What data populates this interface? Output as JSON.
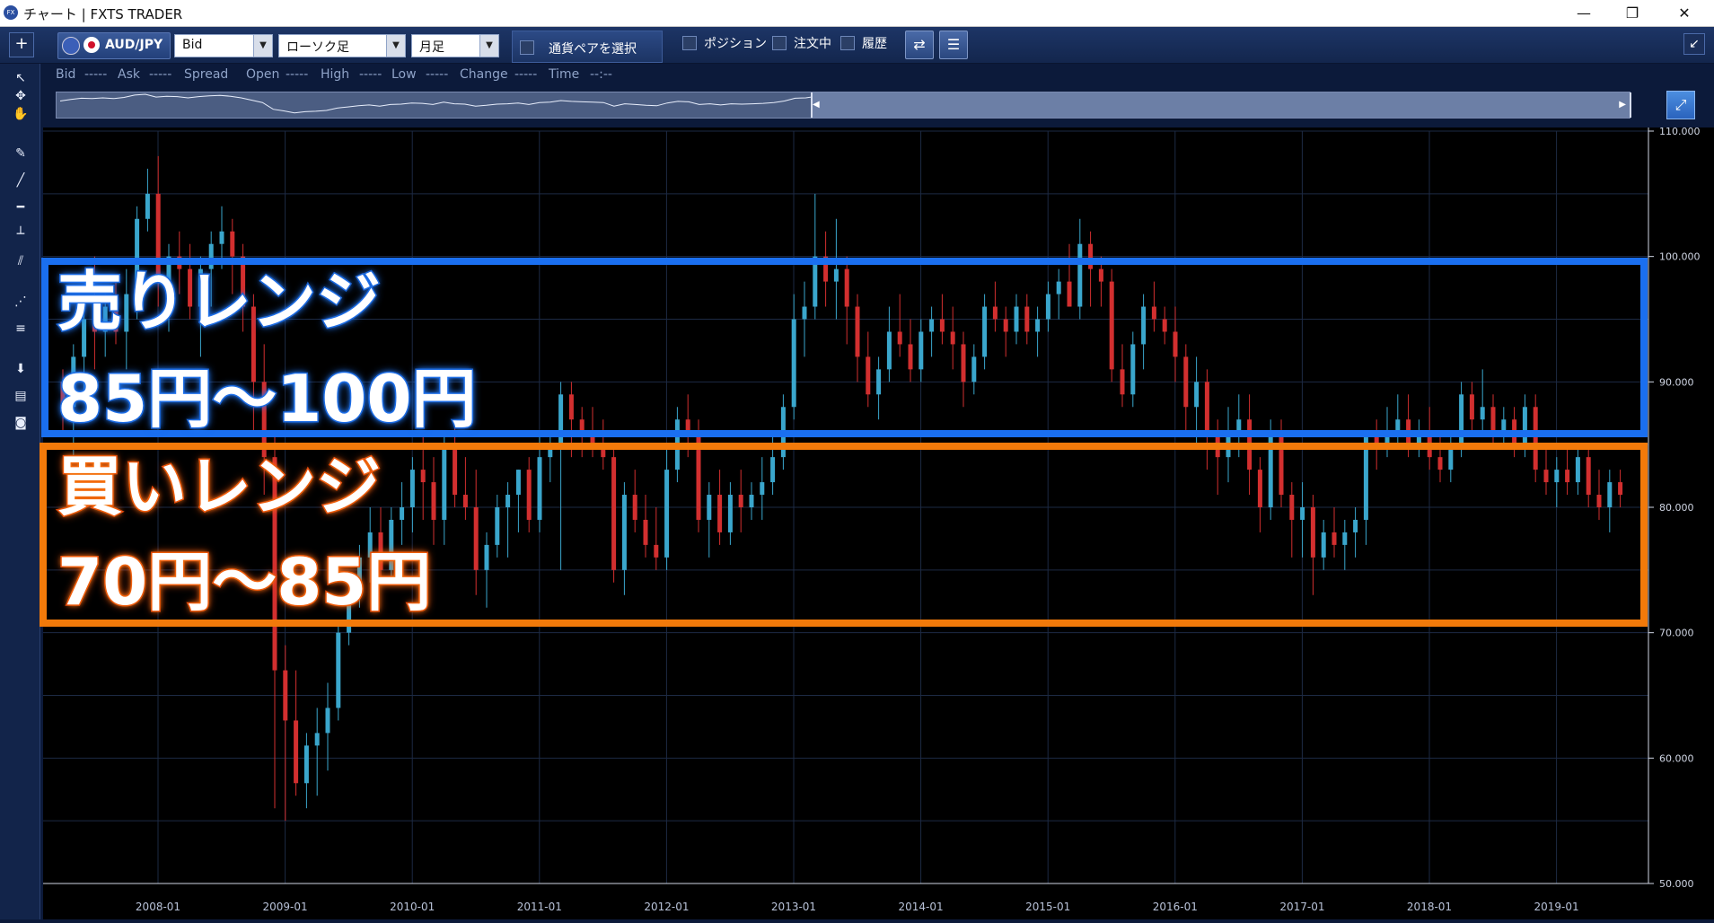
{
  "window": {
    "title": "チャート | FXTS TRADER",
    "app_icon": "FX",
    "buttons": {
      "minimize": "—",
      "restore": "❐",
      "close": "✕"
    }
  },
  "toolbar": {
    "add_label": "+",
    "pair": "AUD/JPY",
    "price_type": "Bid",
    "chart_type": "ローソク足",
    "timeframe": "月足",
    "pair_select_label": "通貨ペアを選択",
    "position_label": "ポジション",
    "orders_label": "注文中",
    "history_label": "履歴",
    "collapse_icon": "↙"
  },
  "info": {
    "bid_label": "Bid",
    "bid_val": "-----",
    "ask_label": "Ask",
    "ask_val": "-----",
    "spread_label": "Spread",
    "open_label": "Open",
    "open_val": "-----",
    "high_label": "High",
    "high_val": "-----",
    "low_label": "Low",
    "low_val": "-----",
    "change_label": "Change",
    "change_val": "-----",
    "time_label": "Time",
    "time_val": "--:--"
  },
  "overlays": {
    "sell_title": "売りレンジ",
    "sell_range": "85円～100円",
    "buy_title": "買いレンジ",
    "buy_range": "70円～85円"
  },
  "colors": {
    "up": "#3aa6cc",
    "down": "#d22f2f",
    "sell_box": "#1a6ff0",
    "buy_box": "#f27a0a"
  },
  "chart_data": {
    "type": "candlestick",
    "ylim": [
      50,
      110
    ],
    "y_ticks": [
      "110.000",
      "100.000",
      "90.000",
      "80.000",
      "70.000",
      "60.000",
      "50.000"
    ],
    "x_ticks": [
      "2008-01",
      "2009-01",
      "2010-01",
      "2011-01",
      "2012-01",
      "2013-01",
      "2014-01",
      "2015-01",
      "2016-01",
      "2017-01",
      "2018-01",
      "2019-01"
    ],
    "grid": true,
    "candles": [
      [
        90,
        91,
        86,
        88
      ],
      [
        88,
        93,
        84,
        92
      ],
      [
        92,
        96,
        89,
        95
      ],
      [
        95,
        100,
        91,
        94
      ],
      [
        94,
        97,
        92,
        96
      ],
      [
        96,
        98,
        93,
        94
      ],
      [
        94,
        99,
        91,
        97
      ],
      [
        97,
        104,
        95,
        103
      ],
      [
        103,
        107,
        102,
        105
      ],
      [
        105,
        108,
        96,
        98
      ],
      [
        98,
        101,
        94,
        100
      ],
      [
        100,
        102,
        97,
        99
      ],
      [
        99,
        101,
        95,
        96
      ],
      [
        96,
        100,
        92,
        99
      ],
      [
        99,
        102,
        96,
        101
      ],
      [
        101,
        104,
        99,
        102
      ],
      [
        102,
        103,
        97,
        100
      ],
      [
        100,
        101,
        94,
        96
      ],
      [
        96,
        97,
        86,
        90
      ],
      [
        90,
        93,
        81,
        84
      ],
      [
        84,
        86,
        56,
        67
      ],
      [
        67,
        69,
        55,
        63
      ],
      [
        63,
        67,
        57,
        58
      ],
      [
        58,
        62,
        56,
        61
      ],
      [
        61,
        64,
        57,
        62
      ],
      [
        62,
        66,
        59,
        64
      ],
      [
        64,
        71,
        63,
        70
      ],
      [
        70,
        74,
        69,
        73
      ],
      [
        73,
        77,
        72,
        76
      ],
      [
        76,
        80,
        74,
        78
      ],
      [
        78,
        80,
        74,
        75
      ],
      [
        75,
        80,
        74,
        79
      ],
      [
        79,
        82,
        77,
        80
      ],
      [
        80,
        84,
        78,
        83
      ],
      [
        83,
        86,
        79,
        82
      ],
      [
        82,
        84,
        77,
        79
      ],
      [
        79,
        86,
        77,
        85
      ],
      [
        85,
        87,
        80,
        81
      ],
      [
        81,
        84,
        79,
        80
      ],
      [
        80,
        83,
        73,
        75
      ],
      [
        75,
        78,
        72,
        77
      ],
      [
        77,
        81,
        76,
        80
      ],
      [
        80,
        82,
        76,
        81
      ],
      [
        81,
        83,
        78,
        83
      ],
      [
        83,
        84,
        78,
        79
      ],
      [
        79,
        86,
        78,
        84
      ],
      [
        84,
        86,
        82,
        85
      ],
      [
        85,
        90,
        75,
        89
      ],
      [
        89,
        90,
        84,
        87
      ],
      [
        87,
        88,
        84,
        86
      ],
      [
        86,
        88,
        84,
        85
      ],
      [
        85,
        87,
        83,
        84
      ],
      [
        84,
        85,
        74,
        75
      ],
      [
        75,
        82,
        73,
        81
      ],
      [
        81,
        83,
        78,
        79
      ],
      [
        79,
        81,
        76,
        77
      ],
      [
        77,
        80,
        75,
        76
      ],
      [
        76,
        85,
        75,
        83
      ],
      [
        83,
        88,
        82,
        87
      ],
      [
        87,
        89,
        84,
        86
      ],
      [
        86,
        87,
        78,
        79
      ],
      [
        79,
        82,
        76,
        81
      ],
      [
        81,
        83,
        77,
        78
      ],
      [
        78,
        82,
        77,
        81
      ],
      [
        81,
        83,
        78,
        80
      ],
      [
        80,
        82,
        79,
        81
      ],
      [
        81,
        84,
        79,
        82
      ],
      [
        82,
        86,
        81,
        84
      ],
      [
        84,
        89,
        83,
        88
      ],
      [
        88,
        97,
        87,
        95
      ],
      [
        95,
        98,
        92,
        96
      ],
      [
        96,
        105,
        95,
        100
      ],
      [
        100,
        102,
        96,
        98
      ],
      [
        98,
        103,
        95,
        99
      ],
      [
        99,
        100,
        93,
        96
      ],
      [
        96,
        97,
        90,
        92
      ],
      [
        92,
        94,
        88,
        89
      ],
      [
        89,
        92,
        87,
        91
      ],
      [
        91,
        96,
        90,
        94
      ],
      [
        94,
        97,
        92,
        93
      ],
      [
        93,
        95,
        90,
        91
      ],
      [
        91,
        95,
        90,
        94
      ],
      [
        94,
        96,
        92,
        95
      ],
      [
        95,
        97,
        93,
        94
      ],
      [
        94,
        96,
        91,
        93
      ],
      [
        93,
        94,
        88,
        90
      ],
      [
        90,
        93,
        89,
        92
      ],
      [
        92,
        97,
        91,
        96
      ],
      [
        96,
        98,
        94,
        95
      ],
      [
        95,
        96,
        92,
        94
      ],
      [
        94,
        97,
        93,
        96
      ],
      [
        96,
        97,
        93,
        94
      ],
      [
        94,
        96,
        92,
        95
      ],
      [
        95,
        98,
        94,
        97
      ],
      [
        97,
        99,
        95,
        98
      ],
      [
        98,
        101,
        96,
        96
      ],
      [
        96,
        103,
        95,
        101
      ],
      [
        101,
        102,
        96,
        99
      ],
      [
        99,
        100,
        96,
        98
      ],
      [
        98,
        99,
        90,
        91
      ],
      [
        91,
        93,
        88,
        89
      ],
      [
        89,
        94,
        88,
        93
      ],
      [
        93,
        97,
        91,
        96
      ],
      [
        96,
        98,
        94,
        95
      ],
      [
        95,
        96,
        93,
        94
      ],
      [
        94,
        96,
        90,
        92
      ],
      [
        92,
        93,
        86,
        88
      ],
      [
        88,
        92,
        85,
        90
      ],
      [
        90,
        91,
        83,
        86
      ],
      [
        86,
        87,
        81,
        84
      ],
      [
        84,
        88,
        82,
        86
      ],
      [
        86,
        89,
        84,
        87
      ],
      [
        87,
        89,
        81,
        83
      ],
      [
        83,
        84,
        78,
        80
      ],
      [
        80,
        87,
        79,
        86
      ],
      [
        86,
        87,
        80,
        81
      ],
      [
        81,
        82,
        76,
        79
      ],
      [
        79,
        82,
        76,
        80
      ],
      [
        80,
        81,
        73,
        76
      ],
      [
        76,
        79,
        75,
        78
      ],
      [
        78,
        80,
        76,
        77
      ],
      [
        77,
        79,
        75,
        78
      ],
      [
        78,
        80,
        76,
        79
      ],
      [
        79,
        83,
        77,
        86
      ],
      [
        86,
        87,
        83,
        85
      ],
      [
        85,
        88,
        84,
        86
      ],
      [
        86,
        89,
        85,
        87
      ],
      [
        87,
        89,
        84,
        85
      ],
      [
        85,
        87,
        84,
        86
      ],
      [
        86,
        88,
        83,
        84
      ],
      [
        84,
        86,
        82,
        83
      ],
      [
        83,
        86,
        82,
        85
      ],
      [
        85,
        90,
        84,
        89
      ],
      [
        89,
        90,
        86,
        87
      ],
      [
        87,
        91,
        86,
        88
      ],
      [
        88,
        89,
        85,
        86
      ],
      [
        86,
        88,
        85,
        87
      ],
      [
        87,
        88,
        84,
        85
      ],
      [
        85,
        89,
        84,
        88
      ],
      [
        88,
        89,
        82,
        83
      ],
      [
        83,
        85,
        81,
        82
      ],
      [
        82,
        84,
        80,
        83
      ],
      [
        83,
        85,
        81,
        82
      ],
      [
        82,
        85,
        81,
        84
      ],
      [
        84,
        85,
        80,
        81
      ],
      [
        81,
        83,
        79,
        80
      ],
      [
        80,
        83,
        78,
        82
      ],
      [
        82,
        83,
        80,
        81
      ]
    ]
  }
}
